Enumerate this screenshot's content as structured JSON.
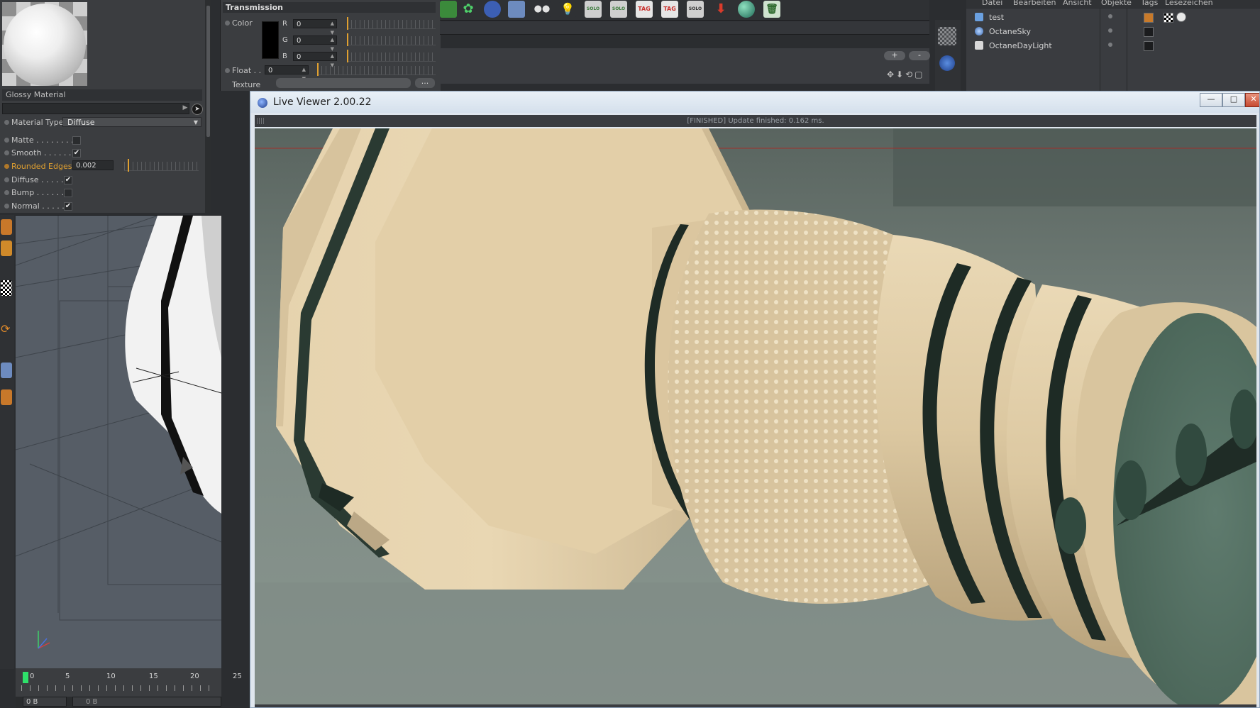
{
  "material": {
    "name": "Glossy Material",
    "type_label": "Material Type",
    "type_value": "Diffuse",
    "params": [
      {
        "label": "Matte . . . . . . . .",
        "checked": false
      },
      {
        "label": "Smooth . . . . . .",
        "checked": true
      },
      {
        "label": "Rounded Edges",
        "value": "0.002"
      },
      {
        "label": "Diffuse . . . . .",
        "checked": true
      },
      {
        "label": "Bump . . . . . .",
        "checked": false
      },
      {
        "label": "Normal . . . . .",
        "checked": true
      }
    ],
    "check_mark": "✔"
  },
  "transmission": {
    "title": "Transmission",
    "color_label": "Color",
    "r_label": "R",
    "g_label": "G",
    "b_label": "B",
    "r": "0",
    "g": "0",
    "b": "0",
    "float_label": "Float . .",
    "float_value": "0",
    "texture_label": "Texture",
    "dots": "..."
  },
  "toolbar": {
    "solo": "SOLO",
    "tag": "TAG"
  },
  "viewport_header": {
    "plus": "+",
    "minus": "-"
  },
  "object_manager": {
    "menu": [
      "Datei",
      "Bearbeiten",
      "Ansicht",
      "Objekte",
      "Tags",
      "Lesezeichen"
    ],
    "objects": [
      {
        "name": "test"
      },
      {
        "name": "OctaneSky"
      },
      {
        "name": "OctaneDayLight"
      }
    ]
  },
  "timeline": {
    "ticks": [
      "0",
      "5",
      "10",
      "15",
      "20",
      "25"
    ],
    "status_left": "0 B",
    "status_mid": "0 B"
  },
  "live_viewer": {
    "title": "Live Viewer 2.00.22",
    "status": "[FINISHED] Update finished: 0.162 ms.",
    "min": "—",
    "max": "□",
    "close": "✕"
  }
}
